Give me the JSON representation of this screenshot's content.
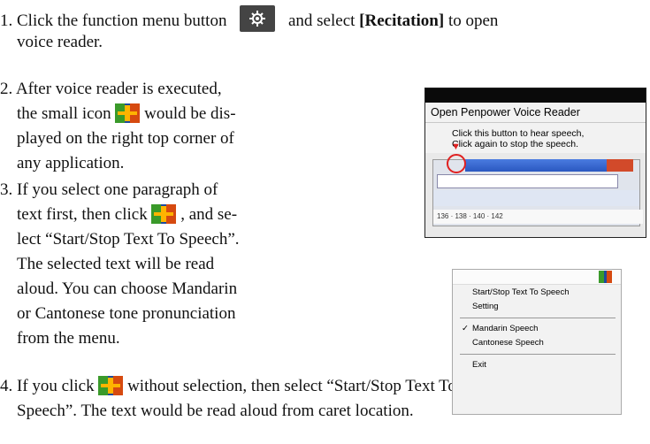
{
  "steps": [
    {
      "id": "1",
      "line1_a": "1. Click the function menu button",
      "line1_b": "and select",
      "recitation": "[Recitation]",
      "line1_c": "to open",
      "line2": "voice reader."
    },
    {
      "id": "2",
      "lines": [
        "2. After voice reader is executed,",
        "the small icon",
        "would be dis-",
        "played on the right top corner of",
        "any application."
      ]
    },
    {
      "id": "3",
      "lines": [
        "3. If you select one paragraph of",
        "text first, then click",
        ", and se-",
        "lect “Start/Stop Text To Speech”.",
        "The selected text will be read",
        "aloud. You can choose Mandarin",
        "or Cantonese tone pronunciation",
        "from the menu."
      ]
    },
    {
      "id": "4",
      "line1_a": "4. If you click",
      "line1_b": "without selection, then select “Start/Stop Text To",
      "line2": "Speech”. The text would be read aloud from caret location."
    }
  ],
  "screenshot1": {
    "title": "Open Penpower Voice Reader",
    "tip_line1": "Click this button to hear speech,",
    "tip_line2": "Click again to stop the speech.",
    "ruler": "136 ·  138 ·  140 ·  142"
  },
  "screenshot2": {
    "menu_items": [
      "Start/Stop Text To Speech",
      "Setting",
      "Mandarin Speech",
      "Cantonese Speech",
      "Exit"
    ],
    "checked_index": 2
  },
  "icons": {
    "function_menu": "gear-icon",
    "voice_reader": "voice-reader-icon"
  }
}
